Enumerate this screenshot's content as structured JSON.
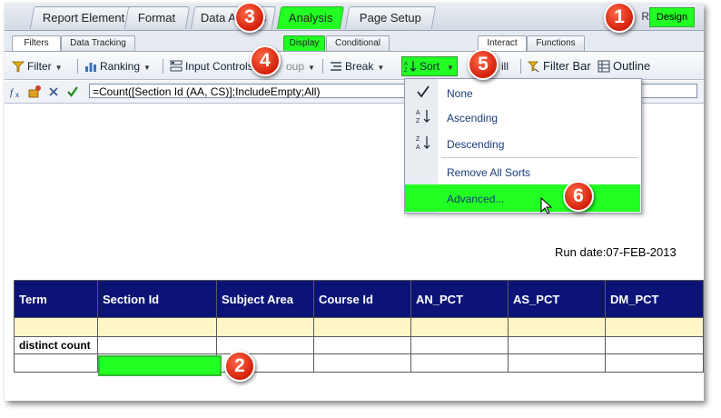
{
  "main_tabs": [
    {
      "label": "Report Element"
    },
    {
      "label": "Format"
    },
    {
      "label": "Data Access"
    },
    {
      "label": "Analysis"
    },
    {
      "label": "Page Setup"
    }
  ],
  "mode": {
    "reading_label": "R",
    "design_label": "Design"
  },
  "sub_tabs_left": [
    {
      "label": "Filters"
    },
    {
      "label": "Data Tracking"
    },
    {
      "label": "Display"
    },
    {
      "label": "Conditional"
    }
  ],
  "sub_tabs_right": [
    {
      "label": "Interact"
    },
    {
      "label": "Functions"
    }
  ],
  "toolbar": {
    "filter": "Filter",
    "ranking": "Ranking",
    "input_controls": "Input Controls",
    "group": "oup",
    "break": "Break",
    "sort": "Sort",
    "drill": "ill",
    "filter_bar": "Filter Bar",
    "outline": "Outline"
  },
  "formula_bar": {
    "formula": "=Count([Section Id (AA, CS)];IncludeEmpty;All)"
  },
  "sort_menu": {
    "items": [
      {
        "label": "None",
        "icon": "check-icon"
      },
      {
        "label": "Ascending",
        "icon": "sort-ascending-icon"
      },
      {
        "label": "Descending",
        "icon": "sort-descending-icon"
      },
      {
        "label": "Remove All Sorts"
      },
      {
        "label": "Advanced..."
      }
    ]
  },
  "report": {
    "run_date_label": "Run date:",
    "run_date": "07-FEB-2013",
    "columns": [
      "Term",
      "Section Id",
      "Subject Area",
      "Course Id",
      "AN_PCT",
      "AS_PCT",
      "DM_PCT"
    ],
    "distinct_count_label": "distinct count"
  },
  "callouts": [
    "1",
    "2",
    "3",
    "4",
    "5",
    "6"
  ],
  "colors": {
    "highlight": "#22ff22",
    "header_bg": "#0b1476",
    "callout": "#d3200a"
  }
}
